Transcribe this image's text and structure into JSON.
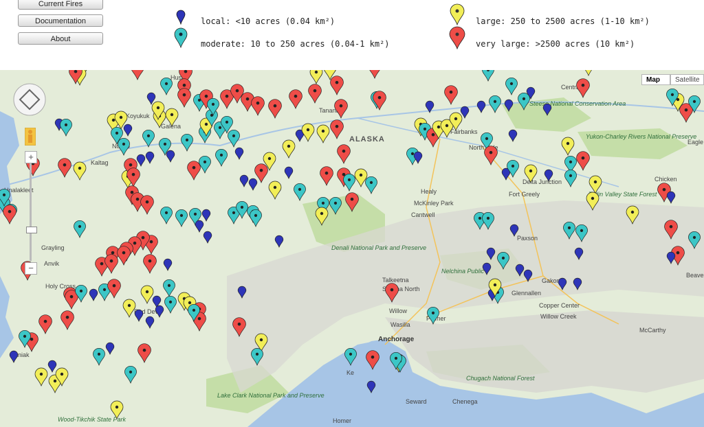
{
  "nav": {
    "current_fires": "Current Fires",
    "documentation": "Documentation",
    "about": "About"
  },
  "legend": {
    "local": "local: <10 acres (0.04 km²)",
    "moderate": "moderate: 10 to 250 acres (0.04-1 km²)",
    "large": "large: 250 to 2500 acres (1-10 km²)",
    "very_large": "very large: >2500 acres (10 km²)"
  },
  "colors": {
    "local": "#2e35b8",
    "moderate": "#3cc6c6",
    "large": "#f2ee58",
    "very_large": "#ee4d48",
    "land": "#e4ecd9",
    "water": "#a7c5e6",
    "park": "#c5dea8"
  },
  "map_type": {
    "map": "Map",
    "satellite": "Satellite"
  },
  "controls": {
    "zoom_in": "+",
    "zoom_out": "−"
  },
  "places": {
    "huslia": "Huslia",
    "koyukuk": "Koyukuk",
    "galena": "Galena",
    "nulato": "Nulato",
    "kaltag": "Kaltag",
    "unalakleet": "Unalakleet",
    "grayling": "Grayling",
    "anvik": "Anvik",
    "holy_cross": "Holy Cross",
    "red_devil": "Red Devil",
    "aniak": "Aniak",
    "tanana": "Tanana",
    "alaska": "ALASKA",
    "fairbanks": "Fairbanks",
    "north_pole": "North Pole",
    "healy": "Healy",
    "mckinley_park": "McKinley Park",
    "cantwell": "Cantwell",
    "denali": "Denali National Park and Preserve",
    "talkeetna": "Talkeetna",
    "susitna_north": "Susitna North",
    "willow": "Willow",
    "palmer": "Palmer",
    "wasilla": "Wasilla",
    "anchorage": "Anchorage",
    "nelchina": "Nelchina Public",
    "paxson": "Paxson",
    "gakona": "Gakona",
    "glennallen": "Glennallen",
    "copper_center": "Copper Center",
    "willow_creek": "Willow Creek",
    "delta_junction": "Delta Junction",
    "fort_greely": "Fort Greely",
    "central": "Central",
    "steese": "Steese National Conservation Area",
    "yukon_charley": "Yukon-Charley Rivers National Preserve",
    "eagle": "Eagle",
    "chicken": "Chicken",
    "tetlin": "Tetlin Valley State Forest",
    "mccarthy": "McCarthy",
    "chugach": "Chugach National Forest",
    "seward": "Seward",
    "chenega": "Chenega",
    "homer": "Homer",
    "lake_clark": "Lake Clark National Park and Preserve",
    "wood_tikchik": "Wood-Tikchik State Park",
    "beaver": "Beave",
    "kenai": "Ke"
  }
}
